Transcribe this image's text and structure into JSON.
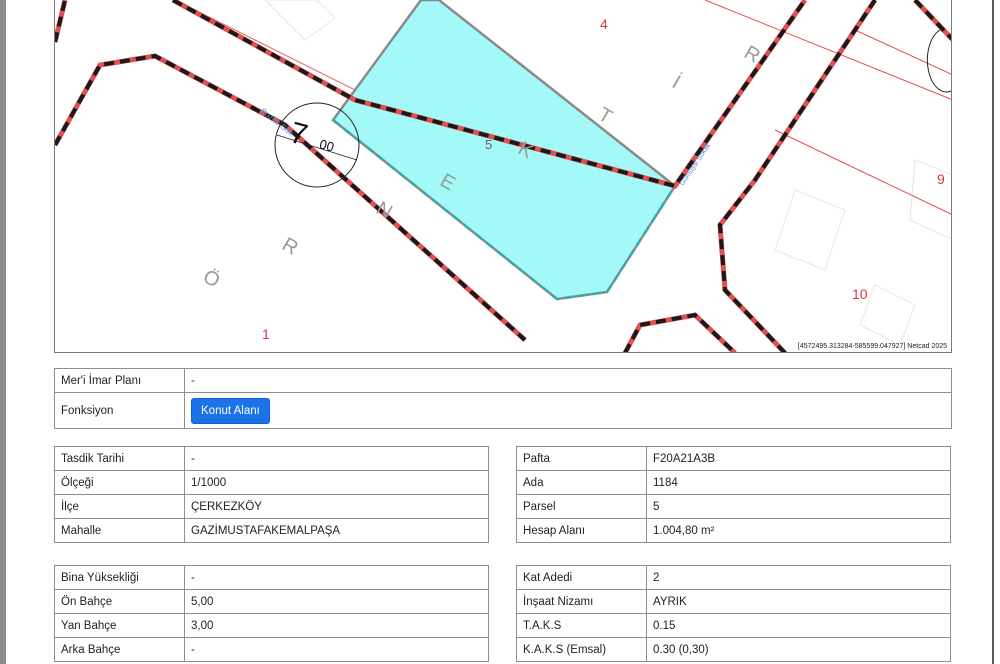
{
  "map": {
    "parcel_label": "5",
    "lot_labels": [
      "4",
      "9",
      "10",
      "1"
    ],
    "street_big_letters": [
      "Ö",
      "R",
      "N",
      "E",
      "K",
      "T",
      "İ",
      "R"
    ],
    "street_name_1": "Bozkır Sok.",
    "street_name_2": "Gümüşal Sokak",
    "height_main": "7",
    "height_sup": "00",
    "height_sub": "00",
    "coords_text": "[4572495.313284-585599.047927]  Netcad 2025",
    "colors": {
      "parcel_fill": "#a3f8f8",
      "parcel_border": "#8a8a8a",
      "road_dash": "#1a1a1a",
      "lot_line": "#e05050",
      "label_red": "#d43c3c",
      "label_grey": "#9a9a9a",
      "street_blue": "#4a90d9"
    }
  },
  "plan": {
    "rows": [
      {
        "label": "Mer'i İmar Planı",
        "value": "-"
      }
    ],
    "fonksiyon_label": "Fonksiyon",
    "fonksiyon_button": "Konut Alanı",
    "button_color": "#1a73e8"
  },
  "left1": [
    {
      "label": "Tasdik Tarihi",
      "value": "-"
    },
    {
      "label": "Ölçeği",
      "value": "1/1000"
    },
    {
      "label": "İlçe",
      "value": "ÇERKEZKÖY"
    },
    {
      "label": "Mahalle",
      "value": "GAZİMUSTAFAKEMALPAŞA"
    }
  ],
  "right1": [
    {
      "label": "Pafta",
      "value": "F20A21A3B"
    },
    {
      "label": "Ada",
      "value": "1184"
    },
    {
      "label": "Parsel",
      "value": "5"
    },
    {
      "label": "Hesap Alanı",
      "value": "1.004,80 m²"
    }
  ],
  "left2": [
    {
      "label": "Bina Yüksekliği",
      "value": "-"
    },
    {
      "label": "Ön Bahçe",
      "value": "5,00"
    },
    {
      "label": "Yan Bahçe",
      "value": "3,00"
    },
    {
      "label": "Arka Bahçe",
      "value": "-"
    }
  ],
  "right2": [
    {
      "label": "Kat Adedi",
      "value": "2"
    },
    {
      "label": "İnşaat Nizamı",
      "value": "AYRIK"
    },
    {
      "label": "T.A.K.S",
      "value": "0.15"
    },
    {
      "label": "K.A.K.S (Emsal)",
      "value": "0.30 (0,30)"
    }
  ]
}
